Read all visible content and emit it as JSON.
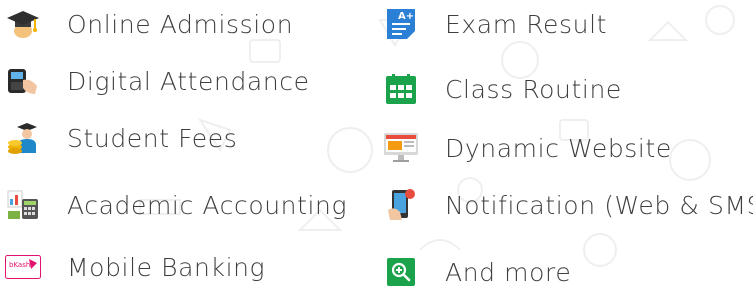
{
  "features_left": [
    {
      "label": "Online Admission",
      "icon": "graduation-cap-icon"
    },
    {
      "label": "Digital Attendance",
      "icon": "fingerprint-device-icon"
    },
    {
      "label": "Student Fees",
      "icon": "student-coins-icon"
    },
    {
      "label": "Academic Accounting",
      "icon": "accounting-calculator-icon"
    },
    {
      "label": "Mobile Banking",
      "icon": "bkash-card-icon"
    }
  ],
  "features_right": [
    {
      "label": "Exam Result",
      "icon": "exam-result-document-icon"
    },
    {
      "label": "Class Routine",
      "icon": "calendar-grid-icon"
    },
    {
      "label": "Dynamic Website",
      "icon": "desktop-monitor-icon"
    },
    {
      "label": "Notification (Web & SMS)",
      "icon": "phone-notification-icon"
    },
    {
      "label": "And more",
      "icon": "zoom-in-icon"
    }
  ],
  "colors": {
    "text": "#3e3e3e",
    "accent_blue": "#2b7fd4",
    "accent_green": "#1aa34a",
    "pattern": "#f2f2f2"
  }
}
